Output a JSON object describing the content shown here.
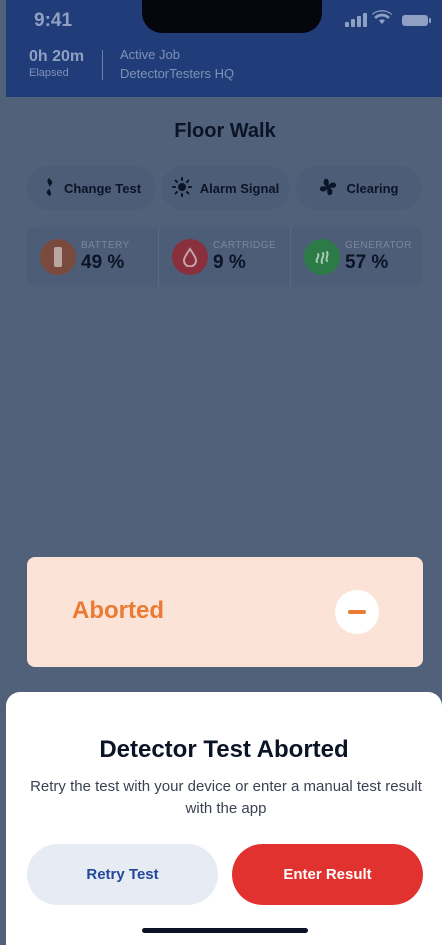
{
  "status_bar": {
    "time": "9:41"
  },
  "header": {
    "elapsed_value": "0h 20m",
    "elapsed_label": "Elapsed",
    "job_label": "Active Job",
    "job_name": "DetectorTesters HQ"
  },
  "page_title": "Floor Walk",
  "actions": [
    {
      "label": "Change Test",
      "icon": "smoke-icon"
    },
    {
      "label": "Alarm Signal",
      "icon": "sun-icon"
    },
    {
      "label": "Clearing",
      "icon": "fan-icon"
    }
  ],
  "stats": [
    {
      "label": "BATTERY",
      "value": "49 %",
      "icon": "battery-icon",
      "color": "#7a4a3c"
    },
    {
      "label": "CARTRIDGE",
      "value": "9 %",
      "icon": "drop-icon",
      "color": "#8a2f3c"
    },
    {
      "label": "GENERATOR",
      "value": "57 %",
      "icon": "heat-icon",
      "color": "#2c7a45"
    }
  ],
  "status_card": {
    "label": "Aborted",
    "icon": "minus-icon",
    "accent": "#ea7a34"
  },
  "sheet": {
    "title": "Detector Test Aborted",
    "body": "Retry the test with your device or enter a manual test result with the app",
    "retry_label": "Retry Test",
    "enter_label": "Enter Result"
  }
}
